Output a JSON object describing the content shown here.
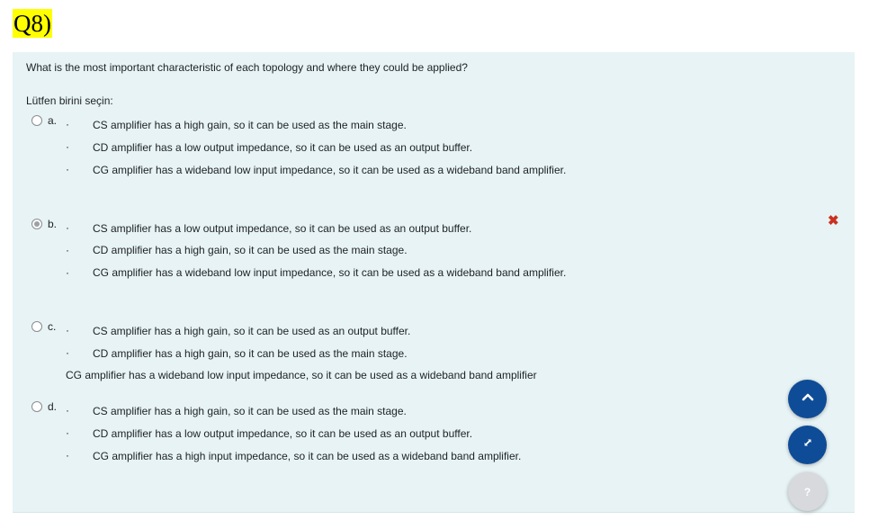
{
  "question_label": "Q8)",
  "question_text": "What is the most important characteristic of each topology and where they could be applied?",
  "prompt": "Lütfen birini seçin:",
  "options": [
    {
      "letter": "a.",
      "checked": false,
      "bullet": "·",
      "lines": [
        "CS amplifier has a high gain, so it can be used as the main stage.",
        "CD amplifier has a low output impedance, so it can be used as an output buffer.",
        "CG amplifier has a wideband low input impedance, so it can be used as a wideband band amplifier."
      ]
    },
    {
      "letter": "b.",
      "checked": true,
      "bullet": "·",
      "lines": [
        "CS amplifier has a low output impedance, so it can be used as an output buffer.",
        "CD amplifier has a high gain, so it can be used as the main stage.",
        "CG amplifier has a wideband low input impedance, so it can be used as a wideband band amplifier."
      ],
      "status_icon": "✖"
    },
    {
      "letter": "c.",
      "checked": false,
      "bullet": "·",
      "lines": [
        "CS amplifier has a high gain, so it can be used as an output buffer.",
        "CD amplifier has a high gain, so it can be used as the main stage.",
        "CG amplifier has a wideband low input impedance, so it can be used as a wideband band amplifier"
      ]
    },
    {
      "letter": "d.",
      "checked": false,
      "bullet": "·",
      "lines": [
        "CS amplifier has a high gain, so it can be used as the main stage.",
        "CD amplifier has a low output impedance, so it can be used as an output buffer.",
        "CG amplifier has a high input impedance, so it can be used as a wideband band amplifier."
      ]
    }
  ],
  "buttons": {
    "scroll_top_icon": "chevron-up-icon",
    "expand_icon": "expand-icon",
    "help_label": "?"
  },
  "colors": {
    "highlight": "#ffff00",
    "card_bg": "#e7f3f5",
    "wrong": "#ca3120",
    "fab_dark": "#0f4c97",
    "fab_light": "#d7d9dc"
  }
}
